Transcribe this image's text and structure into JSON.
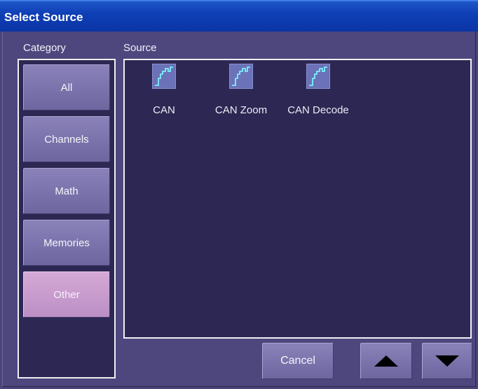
{
  "window": {
    "title": "Select Source"
  },
  "headers": {
    "category": "Category",
    "source": "Source"
  },
  "categories": [
    {
      "label": "All",
      "active": false
    },
    {
      "label": "Channels",
      "active": false
    },
    {
      "label": "Math",
      "active": false
    },
    {
      "label": "Memories",
      "active": false
    },
    {
      "label": "Other",
      "active": true
    }
  ],
  "sources": [
    {
      "label": "CAN",
      "icon": "waveform-icon"
    },
    {
      "label": "CAN Zoom",
      "icon": "waveform-icon"
    },
    {
      "label": "CAN Decode",
      "icon": "waveform-icon"
    }
  ],
  "buttons": {
    "cancel_label": "Cancel",
    "up_icon": "up-arrow-icon",
    "down_icon": "down-arrow-icon"
  },
  "colors": {
    "title_bar": "#0f3fb6",
    "background": "#4d477e",
    "panel": "#2d2753",
    "button": "#7b74ad",
    "active_button": "#c89ccd",
    "waveform": "#7fffff"
  }
}
